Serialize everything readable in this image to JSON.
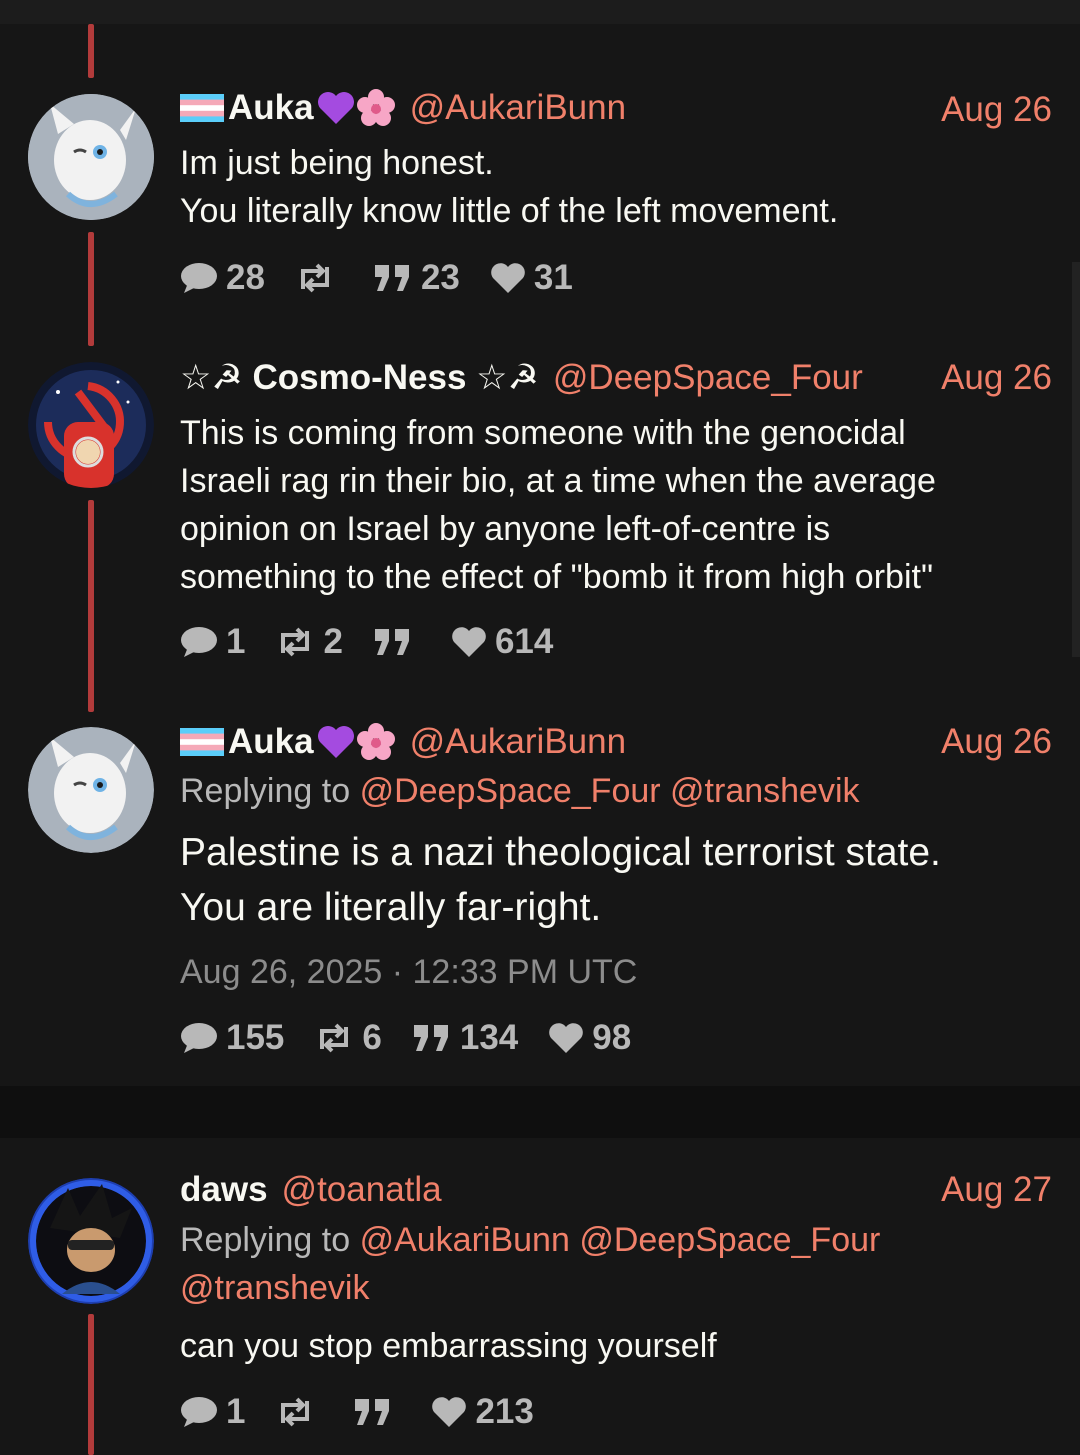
{
  "colors": {
    "accent": "#f0806a",
    "thread_line": "#b23b3b",
    "muted": "#b8b8b8"
  },
  "posts": [
    {
      "fullname": "Auka",
      "emoji_after_name": [
        "purple-heart",
        "cherry-blossom"
      ],
      "flag": "trans-flag",
      "handle": "@AukariBunn",
      "date": "Aug 26",
      "text": "Im just being honest.\nYou literally know little of the left movement.",
      "stats": {
        "replies": "28",
        "retweets": "",
        "quotes": "23",
        "likes": "31"
      }
    },
    {
      "fullname": "☆☭ Cosmo-Ness ☆☭",
      "handle": "@DeepSpace_Four",
      "date": "Aug 26",
      "text": "This is coming from someone with the genocidal\nIsraeli rag rin their bio, at a time when the average\nopinion on Israel by anyone left-of-centre is\nsomething to the effect of \"bomb it from high orbit\"",
      "stats": {
        "replies": "1",
        "retweets": "2",
        "quotes": "",
        "likes": "614"
      }
    },
    {
      "fullname": "Auka",
      "emoji_after_name": [
        "purple-heart",
        "cherry-blossom"
      ],
      "flag": "trans-flag",
      "handle": "@AukariBunn",
      "date": "Aug 26",
      "replying_label": "Replying to",
      "replying_to": [
        "@DeepSpace_Four",
        "@transhevik"
      ],
      "text": "Palestine is a nazi theological terrorist state.\nYou are literally far-right.",
      "timestamp": "Aug 26, 2025 · 12:33 PM UTC",
      "stats": {
        "replies": "155",
        "retweets": "6",
        "quotes": "134",
        "likes": "98"
      }
    },
    {
      "fullname": "daws",
      "handle": "@toanatla",
      "date": "Aug 27",
      "replying_label": "Replying to",
      "replying_to": [
        "@AukariBunn",
        "@DeepSpace_Four",
        "@transhevik"
      ],
      "text": "can you stop embarrassing yourself",
      "stats": {
        "replies": "1",
        "retweets": "",
        "quotes": "",
        "likes": "213"
      }
    }
  ]
}
